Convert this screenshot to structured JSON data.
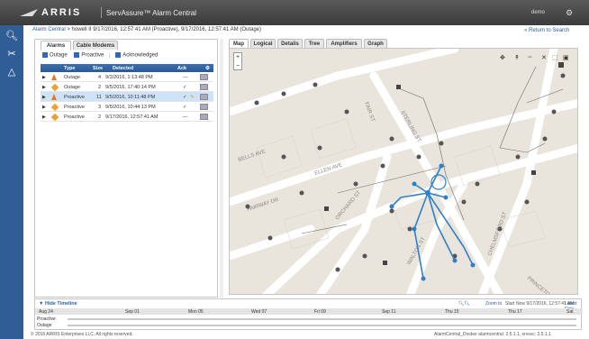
{
  "header": {
    "brand": "ARRIS",
    "app_title": "ServAssure™ Alarm Central",
    "user": "demo"
  },
  "nav": {
    "icons": [
      "search-icon",
      "tools-icon",
      "bell-icon"
    ]
  },
  "breadcrumb": {
    "root": "Alarm Central",
    "separator": ">",
    "current": "howell II 9/17/2016, 12:57:41 AM (Proactive), 9/17/2016, 12:57:41 AM (Outage)",
    "return_link": "« Return to Search"
  },
  "left_tabs": [
    {
      "label": "Alarms",
      "active": true
    },
    {
      "label": "Cable Modems",
      "active": false
    }
  ],
  "filters": {
    "outage": "Outage",
    "proactive": "Proactive",
    "acknowledged": "Acknowledged"
  },
  "alarm_table": {
    "headers": {
      "type": "Type",
      "size": "Size",
      "detected": "Detected",
      "ack": "Ack"
    },
    "rows": [
      {
        "type": "Outage",
        "size": "4",
        "detected": "9/2/2016, 1:13:48 PM",
        "ack": "—",
        "icon": "warning",
        "selected": false
      },
      {
        "type": "Outage",
        "size": "2",
        "detected": "9/5/2016, 17:40:14 PM",
        "ack": "✓",
        "icon": "diamond",
        "selected": false
      },
      {
        "type": "Proactive",
        "size": "11",
        "detected": "9/5/2016, 10:11:48 PM",
        "ack": "✓",
        "icon": "warning",
        "selected": true
      },
      {
        "type": "Proactive",
        "size": "3",
        "detected": "9/5/2016, 10:44:13 PM",
        "ack": "✓",
        "icon": "diamond",
        "selected": false
      },
      {
        "type": "Proactive",
        "size": "2",
        "detected": "9/17/2016, 12:57:41 AM",
        "ack": "—",
        "icon": "diamond",
        "selected": false
      }
    ]
  },
  "map_tabs": [
    "Map",
    "Logical",
    "Details",
    "Tree",
    "Amplifiers",
    "Graph"
  ],
  "map": {
    "streets": [
      "STERLING ST",
      "FAIR ST",
      "BELLS AVE",
      "ELLEN AVE",
      "FAIRWAY DR",
      "ORCHARD ST",
      "CHELMSFORD ST",
      "WALTON ST",
      "PRINCETON"
    ],
    "zoom_in": "+",
    "zoom_out": "−"
  },
  "timeline": {
    "title": "▼ Hide Timeline",
    "ticks": [
      "Aug 24",
      "Sep 01",
      "Mon 05",
      "Wed 07",
      "Fri 09",
      "Sep 11",
      "Thu 15",
      "Thu 17",
      "Sat"
    ],
    "rows": [
      "Proactive",
      "Outage"
    ],
    "zoom_label": "Zoom to",
    "range_label": "Start Now  9/17/2016, 12:57:41 AM",
    "latest_label": "Latest Date"
  },
  "footer": {
    "copyright": "© 2016 ARRIS Enterprises LLC. All rights reserved.",
    "version": "AlarmCentral_Docker   alarmcentral: 2.5.1.1, srvsvc: 2.5.1.1"
  },
  "colors": {
    "accent": "#2f5d95",
    "outage": "#e87a1e",
    "proactive": "#f0a030",
    "map_line": "#2f80c8"
  }
}
